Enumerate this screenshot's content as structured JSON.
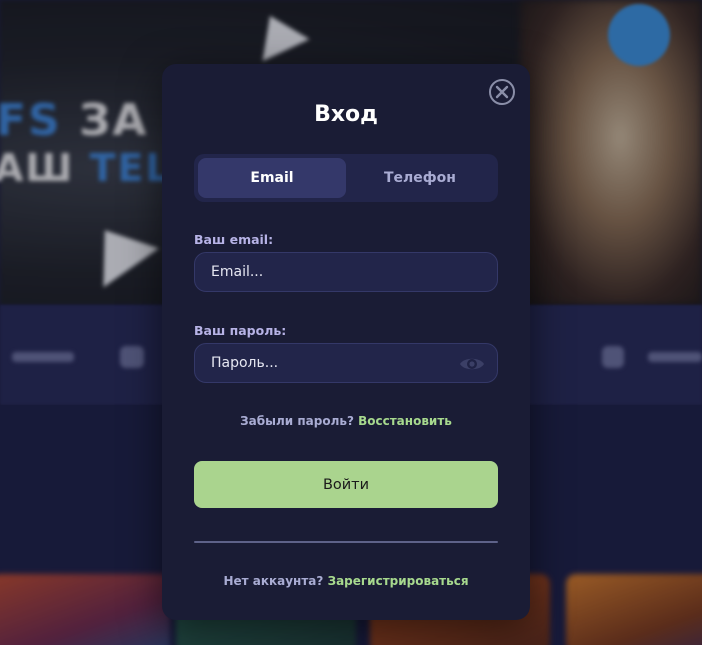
{
  "background": {
    "banner_text_line1": "FS ЗА П",
    "banner_text_line1_accent": "FS",
    "banner_text_line2_plain": "АШ ",
    "banner_text_line2_accent": "TELE",
    "icons": [
      "telegram-plane-icon",
      "telegram-circle-icon"
    ]
  },
  "modal": {
    "title": "Вход",
    "close_icon": "close-circle-icon",
    "tabs": [
      {
        "label": "Email",
        "active": true
      },
      {
        "label": "Телефон",
        "active": false
      }
    ],
    "email": {
      "label": "Ваш email:",
      "placeholder": "Email...",
      "value": ""
    },
    "password": {
      "label": "Ваш пароль:",
      "placeholder": "Пароль...",
      "value": "",
      "toggle_icon": "eye-icon"
    },
    "forgot": {
      "question": "Забыли пароль?",
      "link": "Восстановить"
    },
    "submit_label": "Войти",
    "register": {
      "question": "Нет аккаунта?",
      "link": "Зарегистрироваться"
    }
  },
  "colors": {
    "modal_bg": "#1a1c35",
    "accent_green": "#aad48e",
    "link_green": "#a7d98e",
    "label_purple": "#b7b3e6",
    "tab_active": "#34386a"
  }
}
